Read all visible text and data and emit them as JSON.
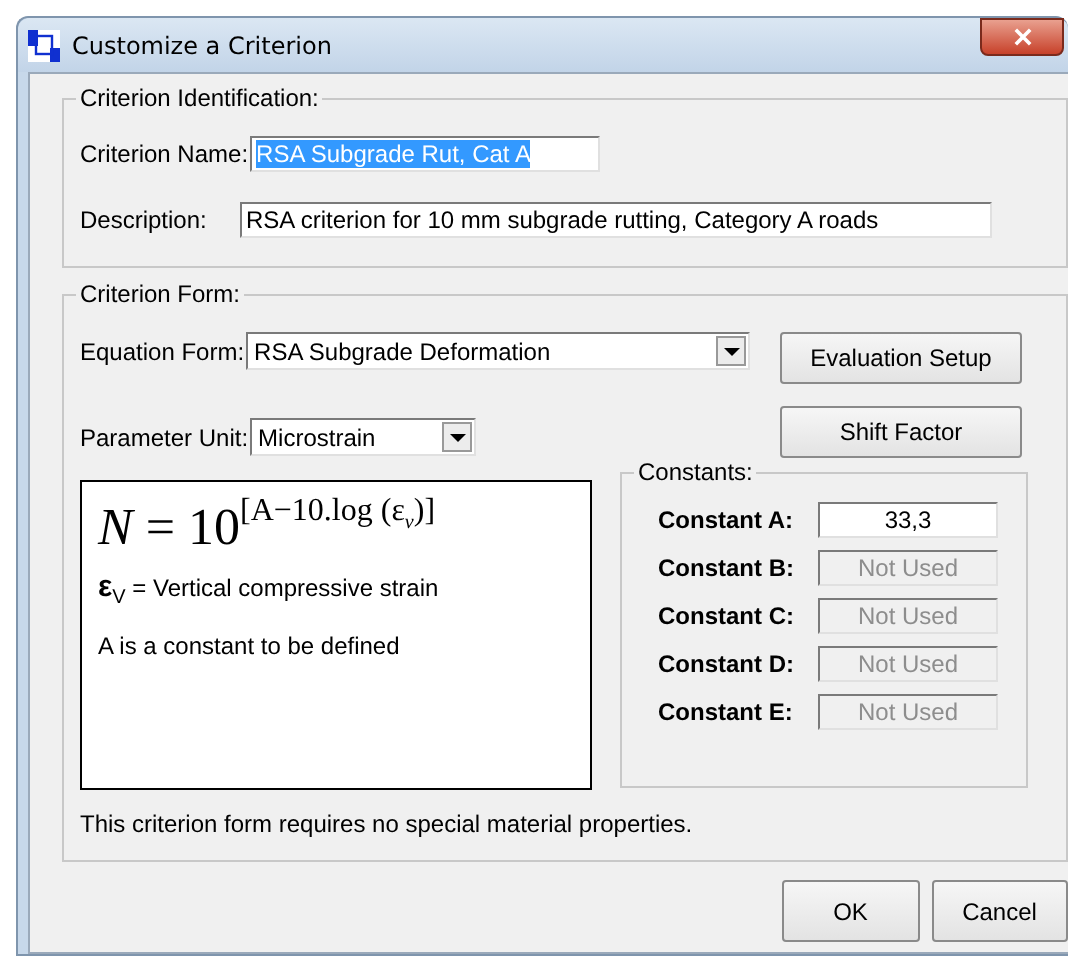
{
  "window": {
    "title": "Customize a Criterion"
  },
  "identification": {
    "title": "Criterion Identification:",
    "name_label": "Criterion Name:",
    "name_value": "RSA Subgrade Rut, Cat A",
    "name_selected": true,
    "description_label": "Description:",
    "description_value": "RSA criterion for 10 mm subgrade rutting, Category A roads"
  },
  "form": {
    "title": "Criterion Form:",
    "equation_label": "Equation Form:",
    "equation_value": "RSA Subgrade Deformation",
    "unit_label": "Parameter Unit:",
    "unit_value": "Microstrain",
    "buttons": [
      "Evaluation Setup",
      "Shift Factor"
    ],
    "formula": {
      "base": "*N* = 10$^{[A−10.log (ε}$$^{ν}$$^{)]}$",
      "legend": "**ε**$_{V}$ = Vertical compressive strain",
      "note": "A is a constant to be defined"
    },
    "constants_title": "Constants:",
    "constants": [
      {
        "label": "Constant A:",
        "value": "33,3",
        "disabled": false
      },
      {
        "label": "Constant B:",
        "value": "Not Used",
        "disabled": true
      },
      {
        "label": "Constant C:",
        "value": "Not Used",
        "disabled": true
      },
      {
        "label": "Constant D:",
        "value": "Not Used",
        "disabled": true
      },
      {
        "label": "Constant E:",
        "value": "Not Used",
        "disabled": true
      }
    ],
    "message": "This criterion form requires no special material properties."
  },
  "buttons": [
    "OK",
    "Cancel"
  ]
}
